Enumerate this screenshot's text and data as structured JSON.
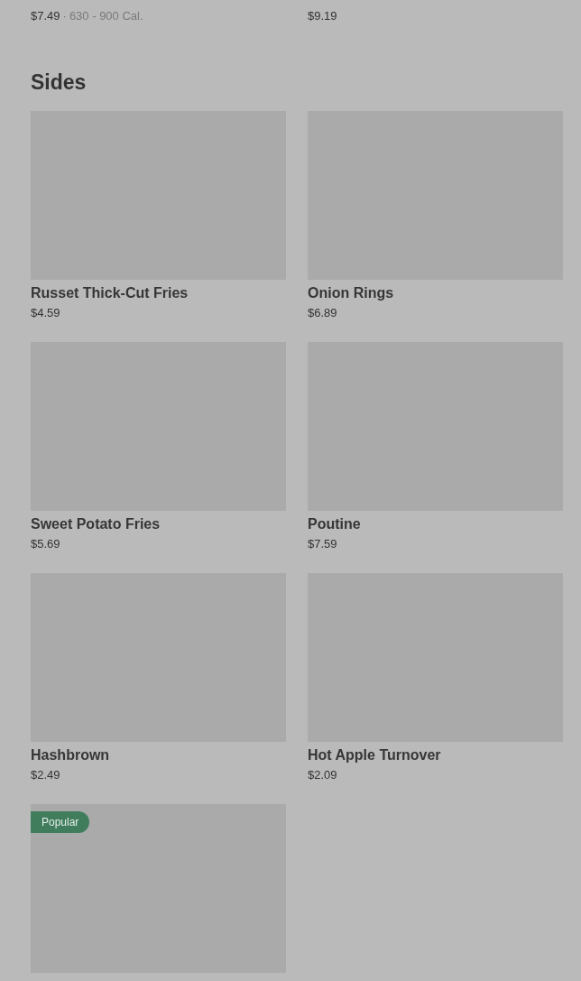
{
  "previous_section_items": [
    {
      "price": "$7.49",
      "separator": "·",
      "calories": "630 - 900 Cal."
    },
    {
      "price": "$9.19"
    }
  ],
  "section": {
    "title": "Sides",
    "items": [
      {
        "name": "Russet Thick-Cut Fries",
        "price": "$4.59"
      },
      {
        "name": "Onion Rings",
        "price": "$6.89"
      },
      {
        "name": "Sweet Potato Fries",
        "price": "$5.69"
      },
      {
        "name": "Poutine",
        "price": "$7.59"
      },
      {
        "name": "Hashbrown",
        "price": "$2.49"
      },
      {
        "name": "Hot Apple Turnover",
        "price": "$2.09"
      },
      {
        "badge": "Popular"
      }
    ]
  }
}
